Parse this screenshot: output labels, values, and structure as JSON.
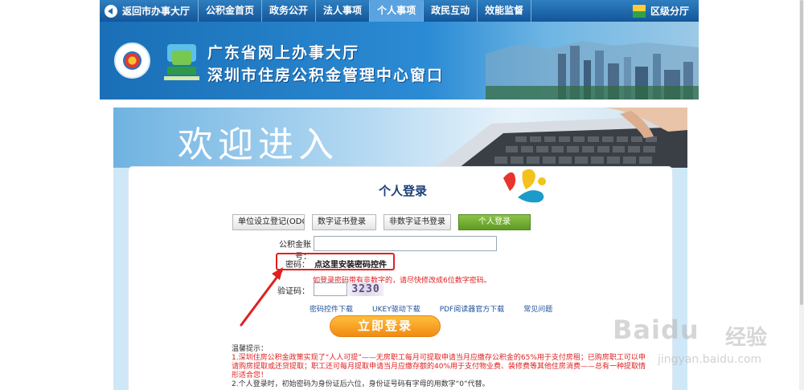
{
  "nav": {
    "back_label": "返回市办事大厅",
    "items": [
      "公积金首页",
      "政务公开",
      "法人事项",
      "个人事项",
      "政民互动",
      "效能监督"
    ],
    "active_index": 3,
    "region_label": "区级分厅"
  },
  "banner": {
    "line1": "广东省网上办事大厅",
    "line2": "深圳市住房公积金管理中心窗口"
  },
  "hero": {
    "welcome": "欢迎进入"
  },
  "login": {
    "title": "个人登录",
    "tabs": [
      "单位设立登记(ODC设",
      "数字证书登录",
      "非数字证书登录",
      "个人登录"
    ],
    "active_tab_index": 3,
    "account_label": "公积金账号：",
    "account_value": "",
    "password_label": "密码：",
    "password_install_link": "点这里安装密码控件",
    "password_hint": "如登录密码带有非数字的，请尽快修改成6位数字密码。",
    "captcha_label": "验证码：",
    "captcha_value": "",
    "captcha_image_text": "3230",
    "links": [
      "密码控件下载",
      "UKEY驱动下载",
      "PDF阅读器官方下载",
      "常见问题"
    ],
    "submit_label": "立即登录"
  },
  "notice": {
    "title": "温馨提示：",
    "item1": "1.深圳住房公积金政策实现了“人人可提”——无房职工每月可提取申请当月应缴存公积金的65%用于支付房租；已购房职工可以申请购房提取或还贷提取；职工还可每月提取申请当月应缴存额的40%用于支付物业费、装修费等其他住房消费——总有一种提取情形适合您！",
    "item2": "2.个人登录时，初始密码为身份证后六位，身份证号码有字母的用数字“0”代替。"
  },
  "watermark": {
    "brand": "Baidu",
    "brand_cn": "经验",
    "url": "jingyan.baidu.com"
  },
  "colors": {
    "nav_blue": "#14569a",
    "active_tab_green": "#6aa82c",
    "highlight_red": "#e02020",
    "submit_orange": "#f08b12"
  }
}
